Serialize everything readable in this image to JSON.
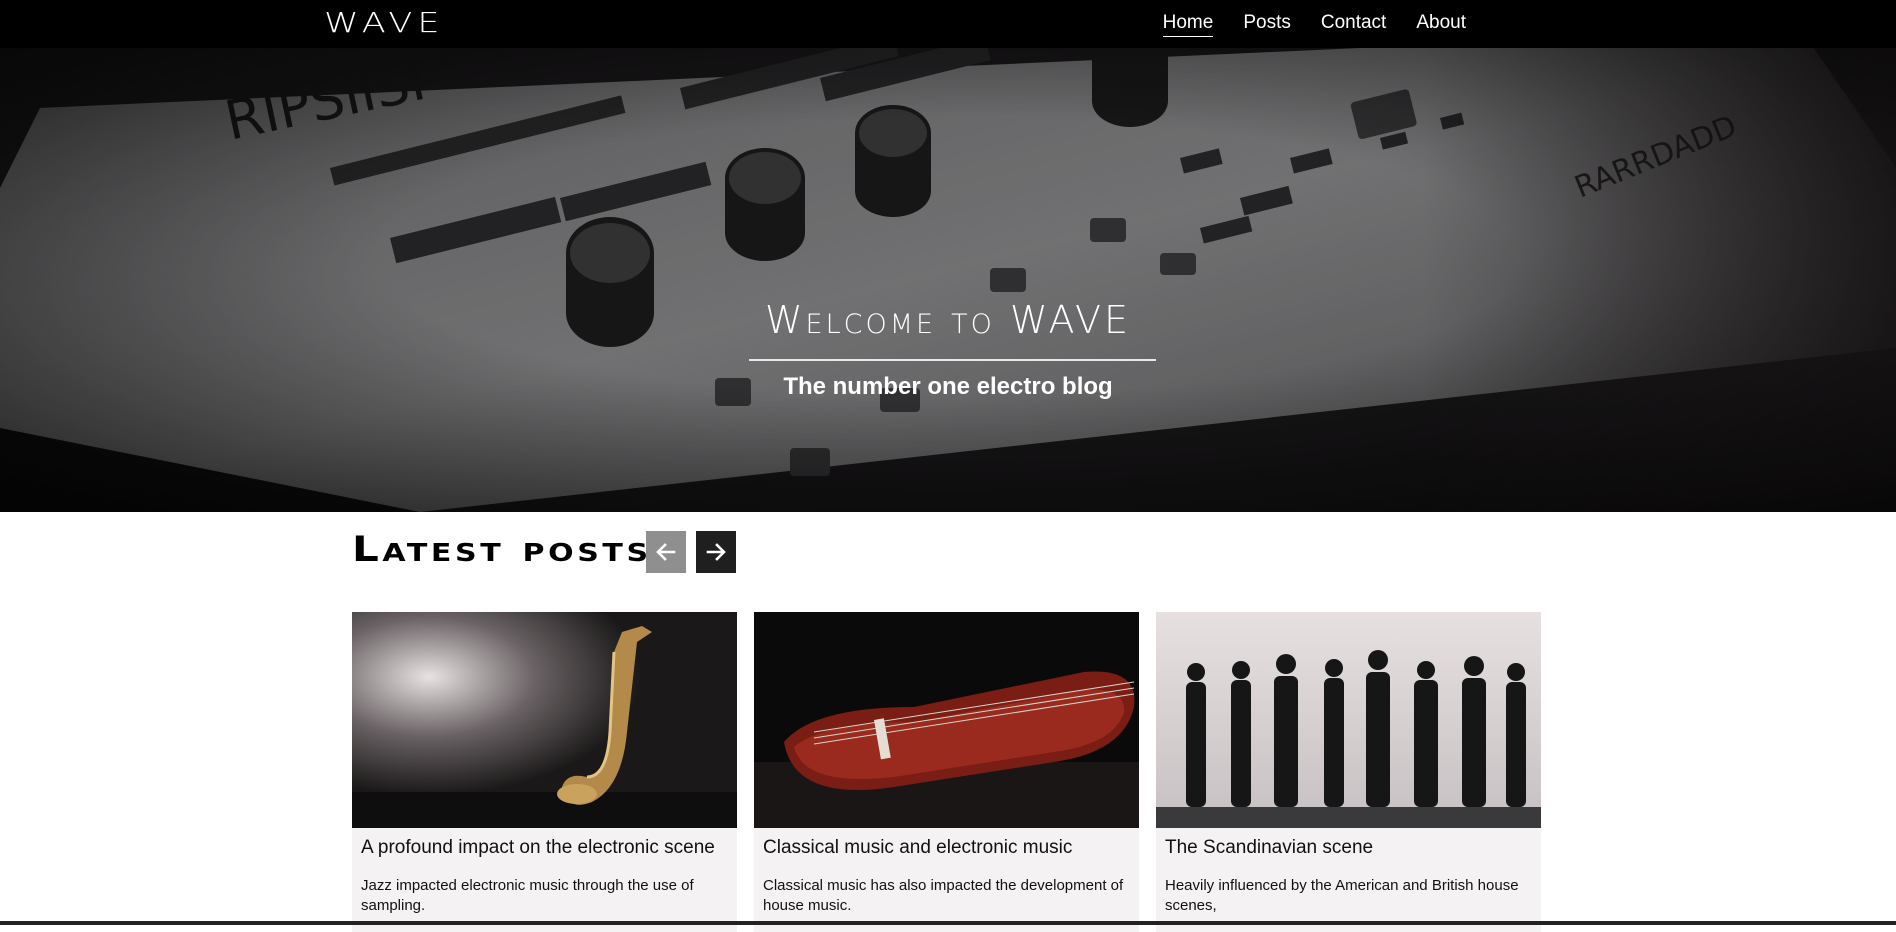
{
  "brand": {
    "logo": "WAVE"
  },
  "nav": {
    "items": [
      {
        "label": "Home",
        "active": true
      },
      {
        "label": "Posts",
        "active": false
      },
      {
        "label": "Contact",
        "active": false
      },
      {
        "label": "About",
        "active": false
      }
    ]
  },
  "hero": {
    "title": "Welcome to WAVE",
    "subtitle": "The number one electro blog",
    "background": "synthesizer-photo"
  },
  "latest": {
    "heading": "Latest posts",
    "prev_icon": "arrow-left-icon",
    "next_icon": "arrow-right-icon",
    "posts": [
      {
        "title": "A profound impact on the electronic scene",
        "excerpt": "Jazz impacted electronic music through the use of sampling.",
        "image": "saxophone-photo"
      },
      {
        "title": "Classical music and electronic music",
        "excerpt": "Classical music has also impacted the development of house music.",
        "image": "violin-photo"
      },
      {
        "title": "The Scandinavian scene",
        "excerpt": "Heavily influenced by the American and British house scenes,",
        "image": "group-photo"
      }
    ]
  },
  "colors": {
    "nav_bg": "#000000",
    "card_bg": "#f4f2f2",
    "prev_button": "#8f8f8f",
    "next_button": "#1f1f1f"
  }
}
